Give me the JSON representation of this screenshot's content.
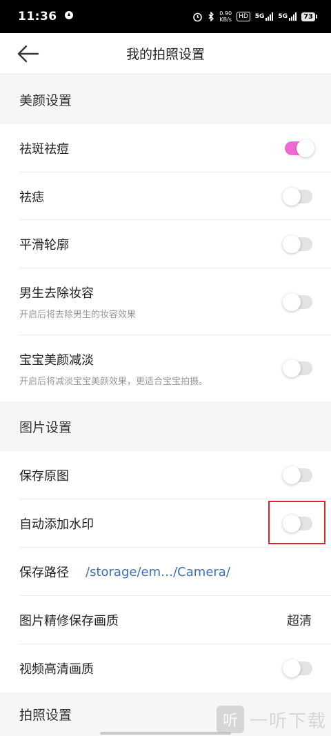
{
  "status_bar": {
    "time": "11:36",
    "network_speed_value": "0.90",
    "network_speed_unit": "KB/s",
    "hd_label": "HD",
    "signal_1": "5G",
    "signal_2": "5G",
    "battery": "73"
  },
  "header": {
    "title": "我的拍照设置"
  },
  "sections": {
    "beauty": "美颜设置",
    "picture": "图片设置",
    "camera": "拍照设置"
  },
  "beauty_items": [
    {
      "label": "祛斑祛痘",
      "on": true
    },
    {
      "label": "祛痣",
      "on": false
    },
    {
      "label": "平滑轮廓",
      "on": false
    },
    {
      "label": "男生去除妆容",
      "sub": "开启后将去除男生的妆容效果",
      "on": false
    },
    {
      "label": "宝宝美颜减淡",
      "sub": "开启后将减淡宝宝美颜效果，更适合宝宝拍摄。",
      "on": false
    }
  ],
  "picture_items": {
    "save_original": {
      "label": "保存原图",
      "on": false
    },
    "auto_watermark": {
      "label": "自动添加水印",
      "on": false
    },
    "save_path": {
      "label": "保存路径",
      "value": "/storage/em…/Camera/"
    },
    "retouch_quality": {
      "label": "图片精修保存画质",
      "value": "超清"
    },
    "video_hd": {
      "label": "视频高清画质",
      "on": false
    }
  },
  "watermark_brand": {
    "glyph": "听",
    "text": "一听下载"
  },
  "colors": {
    "accent_toggle": "#f06ad6",
    "path_link": "#3a6fb3",
    "highlight_box": "#d9262b"
  }
}
